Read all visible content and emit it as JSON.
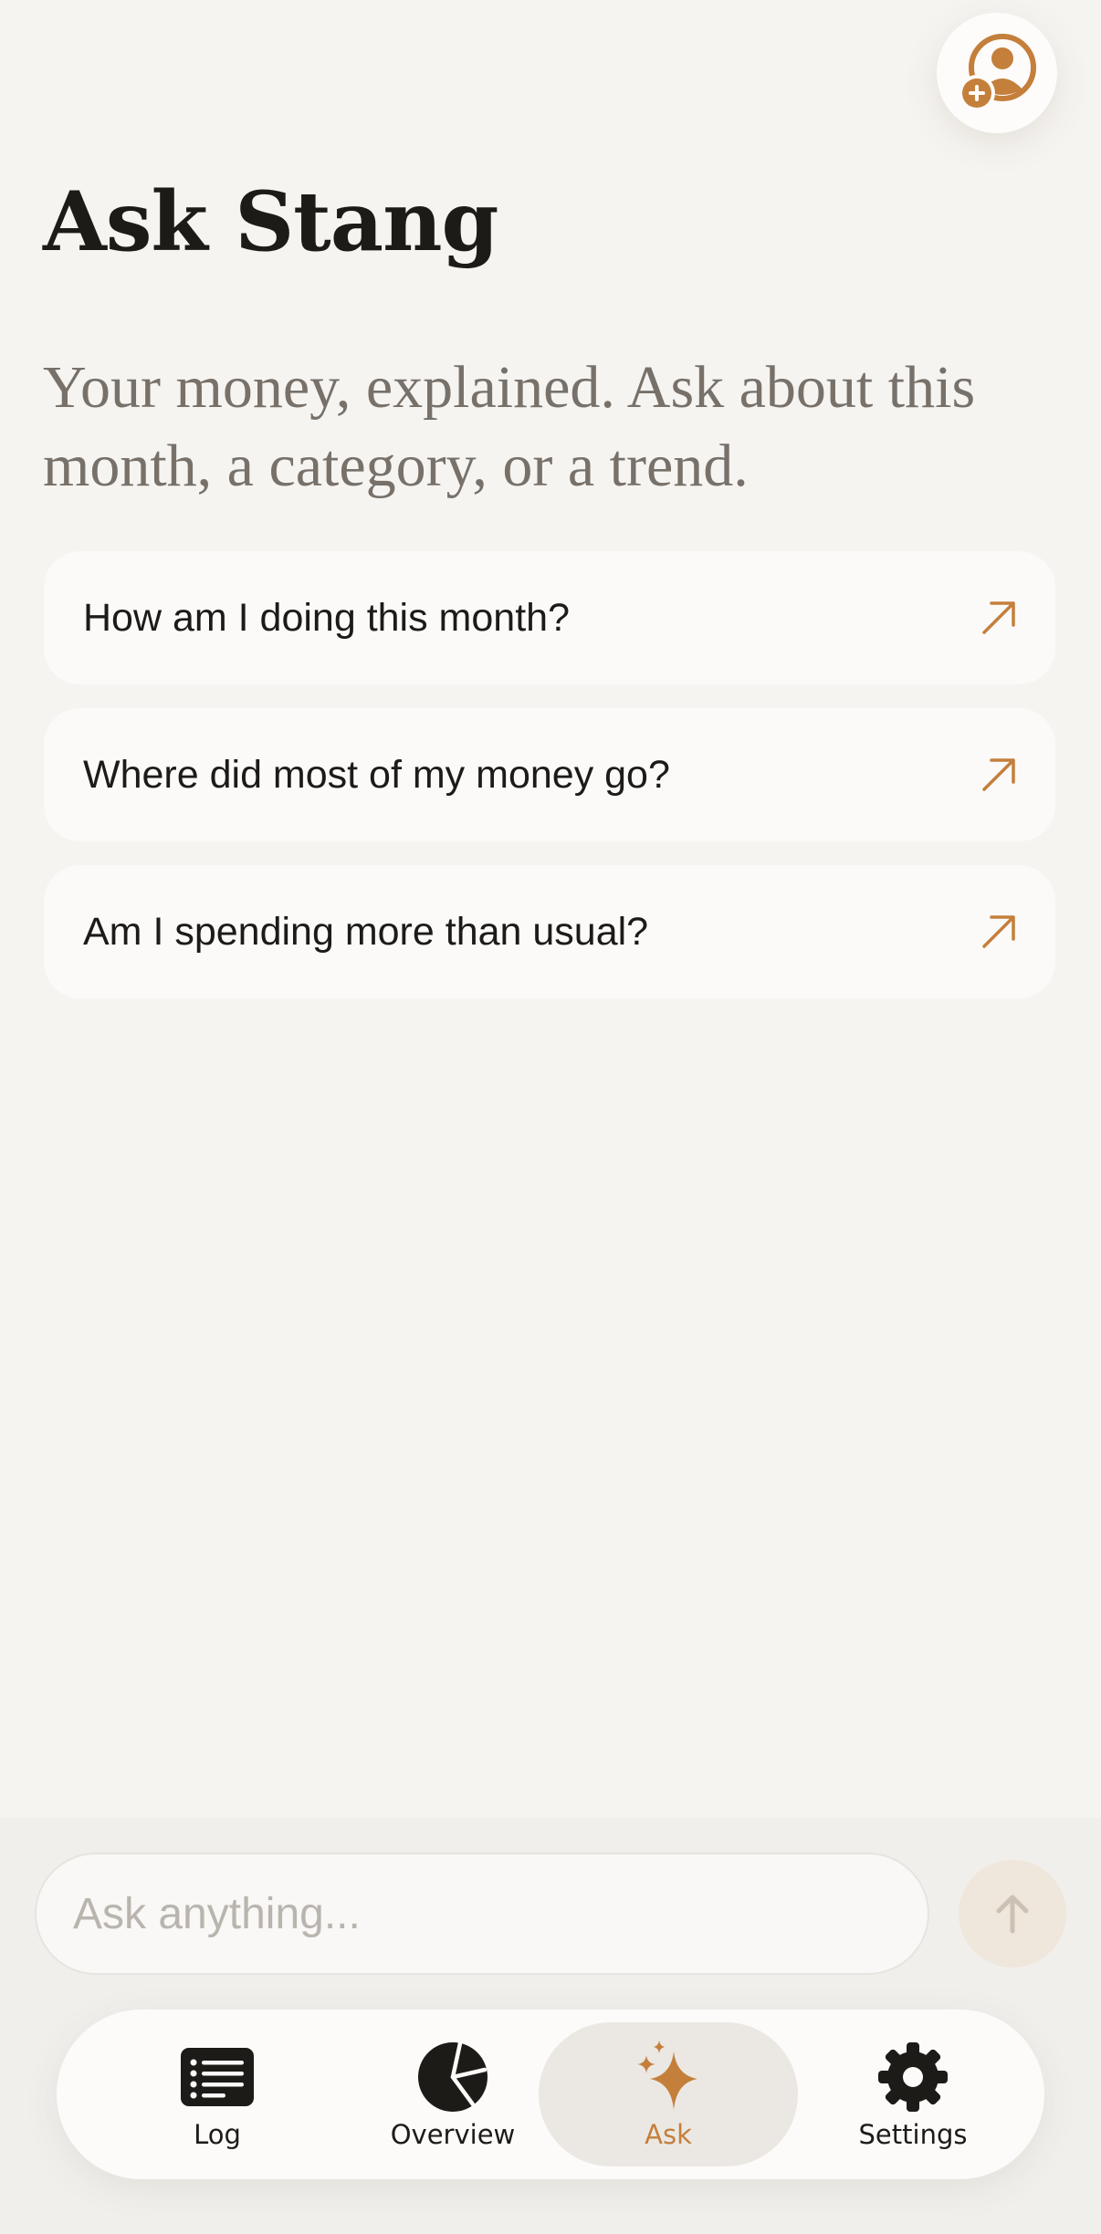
{
  "header": {
    "title": "Ask Stang",
    "subtitle": "Your money, explained. Ask about this month, a category, or a trend."
  },
  "suggestions": [
    {
      "label": "How am I doing this month?"
    },
    {
      "label": "Where did most of my money go?"
    },
    {
      "label": "Am I spending more than usual?"
    }
  ],
  "composer": {
    "placeholder": "Ask anything..."
  },
  "tabs": [
    {
      "label": "Log",
      "icon": "list-icon"
    },
    {
      "label": "Overview",
      "icon": "pie-chart-icon"
    },
    {
      "label": "Ask",
      "icon": "sparkles-icon",
      "active": true
    },
    {
      "label": "Settings",
      "icon": "gear-icon"
    }
  ],
  "colors": {
    "accent": "#c47f3b",
    "background": "#f6f4f1",
    "text": "#1d1b18",
    "muted_text": "#77716a"
  }
}
